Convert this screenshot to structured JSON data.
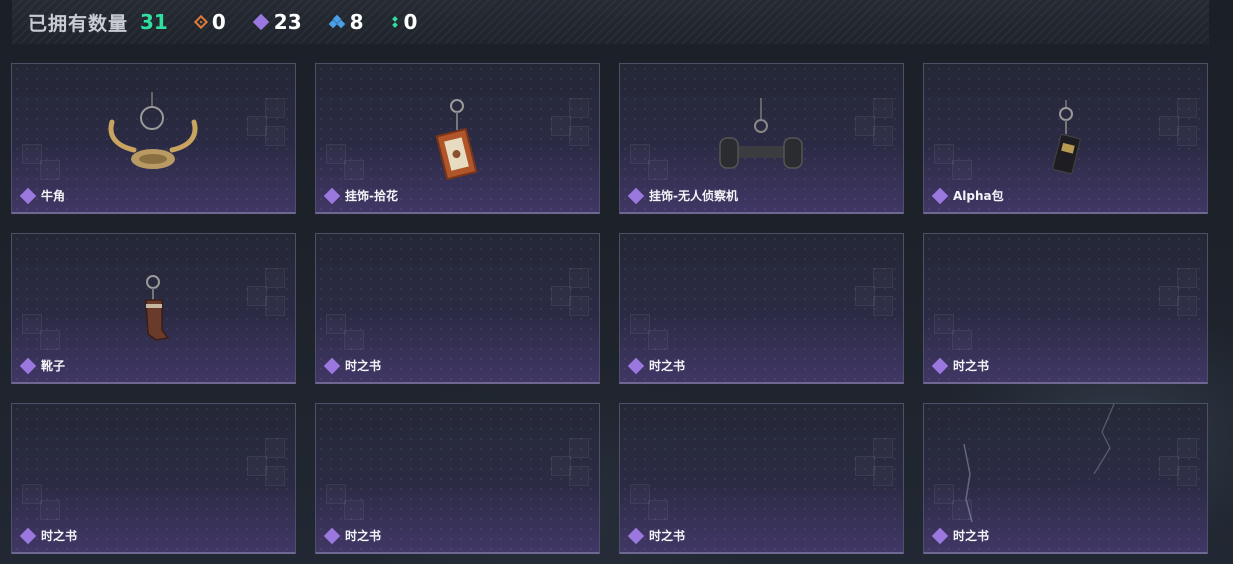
{
  "header": {
    "owned_label": "已拥有数量",
    "owned_count": "31",
    "stats": [
      {
        "icon": "orange-rarity-icon",
        "value": "0",
        "color": "#e07a3a"
      },
      {
        "icon": "purple-rarity-icon",
        "value": "23",
        "color": "#9b78e0"
      },
      {
        "icon": "blue-rarity-icon",
        "value": "8",
        "color": "#4aa0e8"
      },
      {
        "icon": "green-rarity-icon",
        "value": "0",
        "color": "#2fe0a0"
      }
    ]
  },
  "items": [
    {
      "name": "牛角",
      "art": "horn-charm",
      "rarity": "purple"
    },
    {
      "name": "挂饰-拾花",
      "art": "flower-frame-charm",
      "rarity": "purple"
    },
    {
      "name": "挂饰-无人侦察机",
      "art": "drone-charm",
      "rarity": "purple"
    },
    {
      "name": "Alpha包",
      "art": "alpha-pack-charm",
      "rarity": "purple"
    },
    {
      "name": "靴子",
      "art": "boot-charm",
      "rarity": "purple"
    },
    {
      "name": "时之书",
      "art": "none",
      "rarity": "purple"
    },
    {
      "name": "时之书",
      "art": "none",
      "rarity": "purple"
    },
    {
      "name": "时之书",
      "art": "none",
      "rarity": "purple"
    },
    {
      "name": "时之书",
      "art": "none",
      "rarity": "purple"
    },
    {
      "name": "时之书",
      "art": "none",
      "rarity": "purple"
    },
    {
      "name": "时之书",
      "art": "none",
      "rarity": "purple"
    },
    {
      "name": "时之书",
      "art": "none",
      "rarity": "purple"
    }
  ]
}
